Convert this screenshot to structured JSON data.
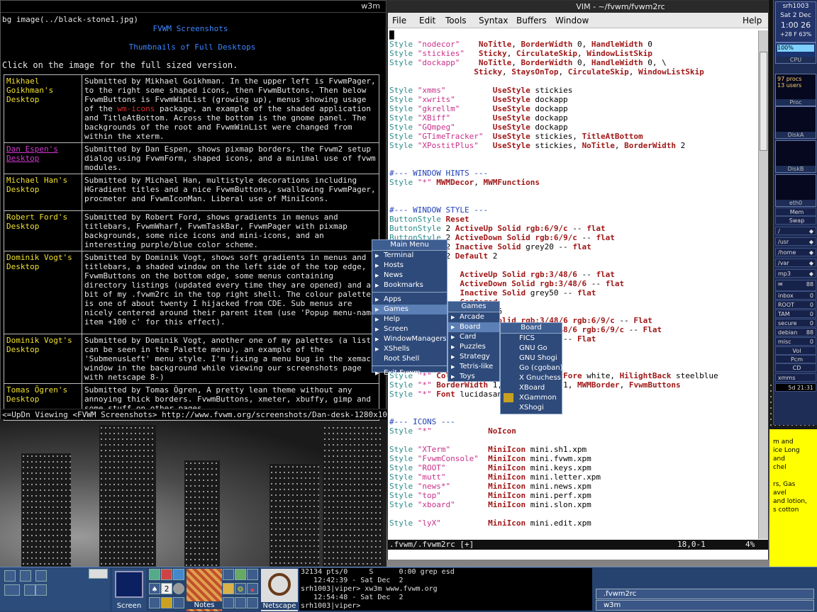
{
  "w3m": {
    "title": "w3m",
    "line1": "bg image(../black-stone1.jpg)",
    "heading": "FVWM Screenshots",
    "subheading": "Thumbnails of Full Desktops",
    "intro": "Click on the image for the full sized version.",
    "rows": [
      {
        "name": "Mikhael\nGoikhman's\nDesktop",
        "desc_a": "Submitted by Mikhael Goikhman. In the upper left is FvwmPager, to the right some shaped icons, then FvwmButtons. Then below FvwmButtons is FvwmWinList (growing up), menus showing usage of the ",
        "desc_link": "wm-icons",
        "desc_b": "\npackage, an example of the shaded application and TitleAtBottom. Across the bottom is the gnome panel. The backgrounds of the root and FvwmWinList were changed from within the xterm."
      },
      {
        "name": "Dan Espen's\nDesktop",
        "desc_a": "Submitted by Dan Espen, shows pixmap borders, the Fvwm2 setup dialog using FvwmForm, shaped icons, and a minimal use of fvwm modules.",
        "desc_link": "",
        "desc_b": ""
      },
      {
        "name": "Michael Han's\nDesktop",
        "desc_a": "Submitted by Michael Han, multistyle decorations including HGradient titles and a nice FvwmButtons, swallowing FvwmPager, procmeter and FvwmIconMan. Liberal use of MiniIcons.",
        "desc_link": "",
        "desc_b": ""
      },
      {
        "name": "Robert Ford's\nDesktop",
        "desc_a": "Submitted by Robert Ford, shows gradients in menus and titlebars, FvwmWharf, FvwmTaskBar, FvwmPager with pixmap backgrounds, some nice icons and mini-icons, and an interesting purple/blue color scheme.",
        "desc_link": "",
        "desc_b": ""
      },
      {
        "name": "Dominik Vogt's\nDesktop",
        "desc_a": "Submitted by Dominik Vogt, shows soft gradients in menus and titlebars, a shaded window on the left side of the top edge, FvwmButtons on the bottom edge, some menus containing directory listings (updated every time they are opened) and a bit of my .fvwm2rc in the top right shell. The colour palette is one of about twenty I hijacked from CDE. Sub menus are nicely centered around their parent item (use 'Popup menu-name item +100 c' for this effect).",
        "desc_link": "",
        "desc_b": ""
      },
      {
        "name": "Dominik Vogt's\nDesktop",
        "desc_a": "Submitted by Dominik Vogt, another one of my palettes (a list can be seen in the Palette menu), an example of the 'SubmenusLeft' menu style. I'm fixing a menu bug in the xemacs window in the background while viewing our screenshots page with netscape 8-)",
        "desc_link": "",
        "desc_b": ""
      },
      {
        "name": "Tomas Ögren's\nDesktop",
        "desc_a": "Submitted by Tomas Ögren, A pretty lean theme without any annoying thick borders. FvwmButtons, xmeter, xbuffy, gimp and some stuff on other pages.",
        "desc_link": "",
        "desc_b": ""
      }
    ],
    "status": "<=UpDn Viewing <FVWM Screenshots> http://www.fvwm.org/screenshots/Dan-desk-1280x1024.gif"
  },
  "vim": {
    "title": "VIM - ~/fvwm/fvwm2rc",
    "menus": [
      "File",
      "Edit",
      "Tools",
      "Syntax",
      "Buffers",
      "Window",
      "Help"
    ],
    "status": ".fvwm/.fvwm2rc [+]",
    "pos": "18,0-1",
    "pct": "4%"
  },
  "main_menu": {
    "title": "Main Menu",
    "items": [
      "Terminal",
      "Hosts",
      "News",
      "Bookmarks",
      "Apps",
      "Games",
      "Help",
      "Screen",
      "WindowManagers",
      "XShells",
      "Root Shell",
      "Exit Fvwm"
    ]
  },
  "games_menu": {
    "title": "Games",
    "items": [
      "Arcade",
      "Board",
      "Card",
      "Puzzles",
      "Strategy",
      "Tetris-like",
      "Toys"
    ]
  },
  "board_menu": {
    "title": "Board",
    "items": [
      "FICS",
      "GNU Go",
      "GNU Shogi",
      "Go (cgoban)",
      "X Gnuchess",
      "XBoard",
      "XGammon",
      "XShogi"
    ]
  },
  "panel": {
    "host": "srh1003",
    "date": "Sat 2 Dec",
    "time": "1:00 26",
    "temp": "+28 F 63%",
    "pct": "100%",
    "cpu": "CPU",
    "procs": "97 procs",
    "users": "13 users",
    "proc": "Proc",
    "diska": "DiskA",
    "diskb": "DiskB",
    "eth0": "eth0",
    "mem": "Mem",
    "swap": "Swap",
    "mounts": [
      "/",
      "/usr",
      "/home",
      "/var",
      "mp3"
    ],
    "mail": "88",
    "boxes": [
      [
        "inbox",
        "0"
      ],
      [
        "ROOT",
        "0"
      ],
      [
        "TAM",
        "0"
      ],
      [
        "secure",
        "0"
      ],
      [
        "debian",
        "88"
      ],
      [
        "misc",
        "0"
      ]
    ],
    "checks": [
      "Vol",
      "Pcm",
      "CD"
    ],
    "xmms": "xmms",
    "uptime": "5d 21:31"
  },
  "note": "m and\nice Long\nand\nchel\n\nrs, Gas\navel\nand lotion,\ns cotton",
  "taskbar": {
    "screen": "Screen",
    "notes": "Notes",
    "netscape": "Netscape",
    "term": "32134 pts/0     S      0:00 grep esd\n   12:42:39 - Sat Dec  2\nsrh1003|viper> xw3m www.fvwm.org\n   12:54:48 - Sat Dec  2\nsrh1003|viper> ",
    "windows": [
      ".fvwm2rc",
      "w3m"
    ]
  },
  "colors": {
    "menu": "#2e4a7a",
    "panel": "#1e2d55",
    "note": "#ffff00"
  }
}
